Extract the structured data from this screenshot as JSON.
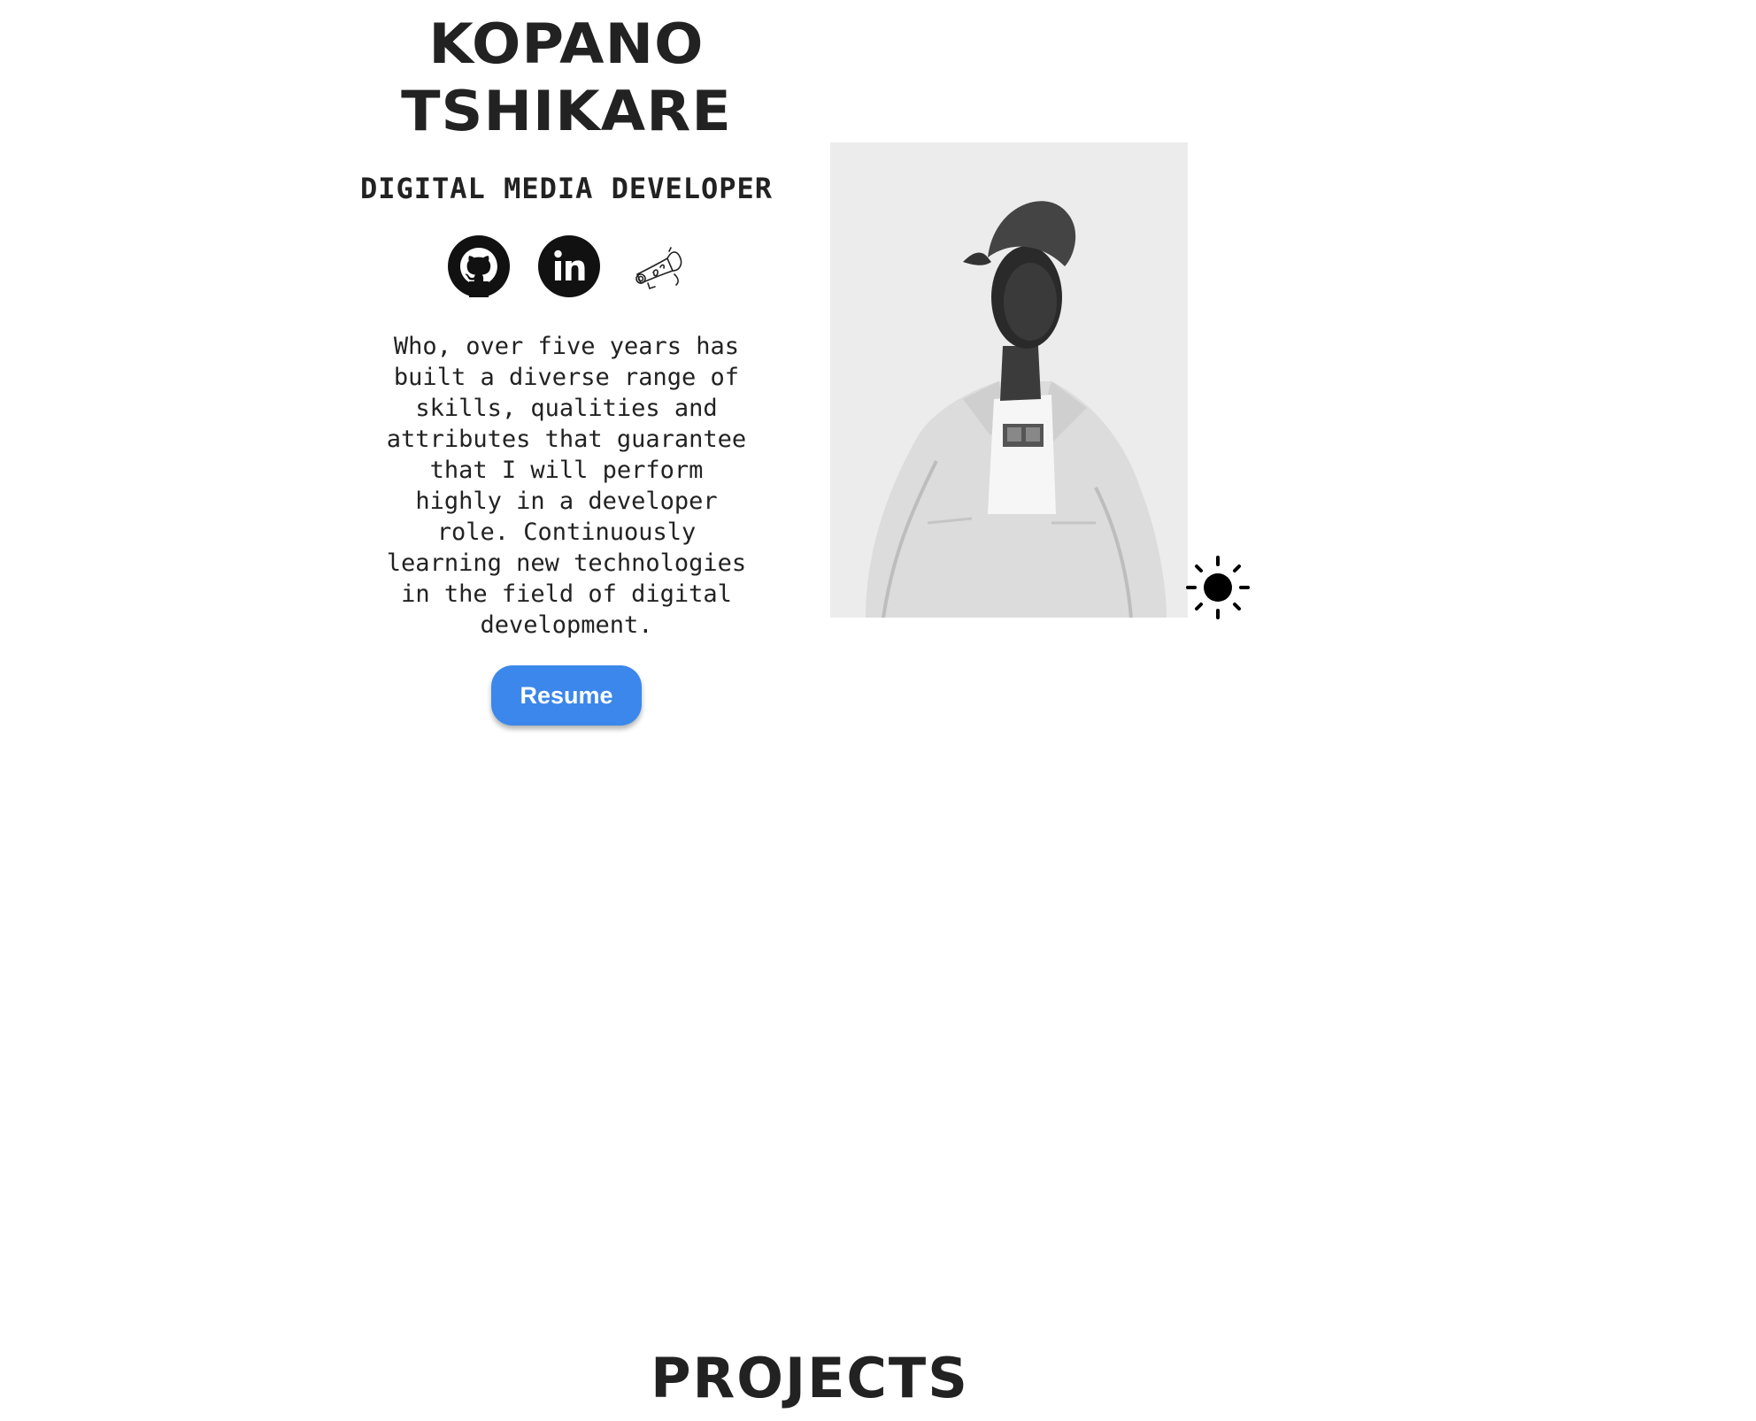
{
  "hero": {
    "name_line1": "KOPANO",
    "name_line2": "TSHIKARE",
    "role": "DIGITAL MEDIA DEVELOPER",
    "bio": "Who, over five years has built a diverse range of skills, qualities and attributes that guarantee that I will perform highly in a developer role. Continuously learning new technologies in the field of digital development.",
    "resume_label": "Resume"
  },
  "socials": [
    {
      "icon": "github-icon"
    },
    {
      "icon": "linkedin-icon"
    },
    {
      "icon": "megaphone-sketch-icon"
    }
  ],
  "portrait": {
    "alt": "portrait photo"
  },
  "theme_toggle": {
    "icon": "sun-icon"
  },
  "projects": {
    "title": "PROJECTS"
  },
  "colors": {
    "text": "#222222",
    "accent": "#3b87eb",
    "background": "#ffffff",
    "photo_bg": "#ececec"
  }
}
